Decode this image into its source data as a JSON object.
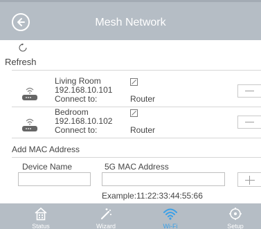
{
  "header": {
    "title": "Mesh Network",
    "back_icon": "arrow-left-icon"
  },
  "refresh": {
    "label": "Refresh",
    "icon": "refresh-icon"
  },
  "nodes": [
    {
      "name": "Living Room",
      "ip": "192.168.10.101",
      "connect_label": "Connect to:",
      "connect_value": "Router",
      "icons": [
        "router-icon",
        "edit-icon",
        "remove-icon"
      ]
    },
    {
      "name": "Bedroom",
      "ip": "192.168.10.102",
      "connect_label": "Connect to:",
      "connect_value": "Router",
      "icons": [
        "router-icon",
        "edit-icon",
        "remove-icon"
      ]
    }
  ],
  "add_mac": {
    "section_label": "Add MAC Address",
    "device_name_label": "Device Name",
    "mac_label": "5G MAC Address",
    "device_name_value": "",
    "mac_value": "",
    "example": "Example:11:22:33:44:55:66",
    "add_icon": "plus-icon"
  },
  "tabs": [
    {
      "label": "Status",
      "icon": "house-icon",
      "active": false
    },
    {
      "label": "Wizard",
      "icon": "magic-wand-icon",
      "active": false
    },
    {
      "label": "Wi-Fi",
      "icon": "wifi-icon",
      "active": true
    },
    {
      "label": "Setup",
      "icon": "gear-icon",
      "active": false
    }
  ],
  "colors": {
    "header_bg": "#b5bdc5",
    "tab_active": "#3aa0e8",
    "text": "#444444"
  }
}
